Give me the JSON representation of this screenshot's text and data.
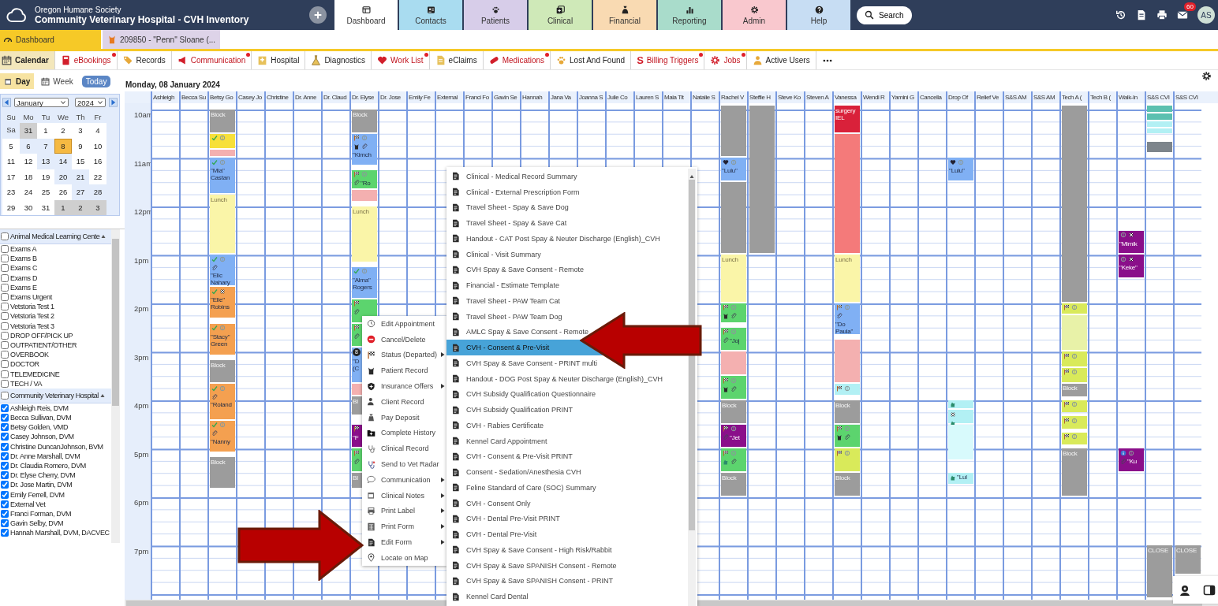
{
  "top_bar": {
    "org": "Oregon Humane Society",
    "title": "Community Veterinary Hospital - CVH Inventory",
    "search": "Search",
    "mail_count": "60",
    "user_initials": "AS"
  },
  "nav_tabs": [
    {
      "label": "Dashboard",
      "selected": true
    },
    {
      "label": "Contacts",
      "selected": false,
      "color": "#a9dcf0"
    },
    {
      "label": "Patients",
      "selected": false,
      "color": "#d7cde9"
    },
    {
      "label": "Clinical",
      "selected": false,
      "color": "#cfe9b8"
    },
    {
      "label": "Financial",
      "selected": false,
      "color": "#f9dab2"
    },
    {
      "label": "Reporting",
      "selected": false,
      "color": "#a9dccb"
    },
    {
      "label": "Admin",
      "selected": false,
      "color": "#f9c8ce"
    },
    {
      "label": "Help",
      "selected": false,
      "color": "#c7ddf3"
    }
  ],
  "open_tabs": [
    {
      "label": "Dashboard",
      "selected": true
    },
    {
      "label": "209850 - \"Penn\" Sloane (...",
      "selected": false
    }
  ],
  "toolbar": [
    {
      "label": "Calendar",
      "selected": true,
      "alert": false
    },
    {
      "label": "eBookings",
      "selected": false,
      "alert": true
    },
    {
      "label": "Records",
      "selected": false,
      "alert": false
    },
    {
      "label": "Communication",
      "selected": false,
      "alert": true
    },
    {
      "label": "Hospital",
      "selected": false,
      "alert": false
    },
    {
      "label": "Diagnostics",
      "selected": false,
      "alert": false
    },
    {
      "label": "Work List",
      "selected": false,
      "alert": true
    },
    {
      "label": "eClaims",
      "selected": false,
      "alert": false
    },
    {
      "label": "Medications",
      "selected": false,
      "alert": true
    },
    {
      "label": "Lost And Found",
      "selected": false,
      "alert": false
    },
    {
      "label": "Billing Triggers",
      "selected": false,
      "alert": true,
      "glyph": "S"
    },
    {
      "label": "Jobs",
      "selected": false,
      "alert": true
    },
    {
      "label": "Active Users",
      "selected": false,
      "alert": false
    }
  ],
  "view_switch": [
    {
      "label": "Day",
      "selected": true
    },
    {
      "label": "Week",
      "selected": false
    }
  ],
  "today_button": "Today",
  "mini_calendar": {
    "month": "January",
    "year": "2024",
    "weekdays": [
      "Su",
      "Mo",
      "Tu",
      "We",
      "Th",
      "Fr",
      "Sa"
    ],
    "days": [
      {
        "label": "31",
        "other_month": true,
        "selected": false
      },
      {
        "label": "1",
        "other_month": false,
        "selected": false
      },
      {
        "label": "2",
        "other_month": false,
        "selected": false
      },
      {
        "label": "3",
        "other_month": false,
        "selected": false
      },
      {
        "label": "4",
        "other_month": false,
        "selected": false
      },
      {
        "label": "5",
        "other_month": false,
        "selected": false
      },
      {
        "label": "6",
        "other_month": false,
        "selected": false
      },
      {
        "label": "7",
        "other_month": false,
        "selected": false
      },
      {
        "label": "8",
        "other_month": false,
        "selected": true
      },
      {
        "label": "9",
        "other_month": false,
        "selected": false
      },
      {
        "label": "10",
        "other_month": false,
        "selected": false
      },
      {
        "label": "11",
        "other_month": false,
        "selected": false
      },
      {
        "label": "12",
        "other_month": false,
        "selected": false
      },
      {
        "label": "13",
        "other_month": false,
        "selected": false
      },
      {
        "label": "14",
        "other_month": false,
        "selected": false
      },
      {
        "label": "15",
        "other_month": false,
        "selected": false
      },
      {
        "label": "16",
        "other_month": false,
        "selected": false
      },
      {
        "label": "17",
        "other_month": false,
        "selected": false
      },
      {
        "label": "18",
        "other_month": false,
        "selected": false
      },
      {
        "label": "19",
        "other_month": false,
        "selected": false
      },
      {
        "label": "20",
        "other_month": false,
        "selected": false
      },
      {
        "label": "21",
        "other_month": false,
        "selected": false
      },
      {
        "label": "22",
        "other_month": false,
        "selected": false
      },
      {
        "label": "23",
        "other_month": false,
        "selected": false
      },
      {
        "label": "24",
        "other_month": false,
        "selected": false
      },
      {
        "label": "25",
        "other_month": false,
        "selected": false
      },
      {
        "label": "26",
        "other_month": false,
        "selected": false
      },
      {
        "label": "27",
        "other_month": false,
        "selected": false
      },
      {
        "label": "28",
        "other_month": false,
        "selected": false
      },
      {
        "label": "29",
        "other_month": false,
        "selected": false
      },
      {
        "label": "30",
        "other_month": false,
        "selected": false
      },
      {
        "label": "31",
        "other_month": false,
        "selected": false
      },
      {
        "label": "1",
        "other_month": true,
        "selected": false
      },
      {
        "label": "2",
        "other_month": true,
        "selected": false
      },
      {
        "label": "3",
        "other_month": true,
        "selected": false
      }
    ]
  },
  "resource_groups": [
    {
      "name": "Animal Medical Learning Cente",
      "checked": false,
      "items": [
        {
          "label": "Exams A",
          "checked": false
        },
        {
          "label": "Exams B",
          "checked": false
        },
        {
          "label": "Exams C",
          "checked": false
        },
        {
          "label": "Exams D",
          "checked": false
        },
        {
          "label": "Exams E",
          "checked": false
        },
        {
          "label": "Exams Urgent",
          "checked": false
        },
        {
          "label": "Vetstoria Test 1",
          "checked": false
        },
        {
          "label": "Vetstoria Test 2",
          "checked": false
        },
        {
          "label": "Vetstoria Test 3",
          "checked": false
        },
        {
          "label": "DROP OFF/PICK UP",
          "checked": false
        },
        {
          "label": "OUTPATIENT/OTHER",
          "checked": false
        },
        {
          "label": "OVERBOOK",
          "checked": false
        },
        {
          "label": "DOCTOR",
          "checked": false
        },
        {
          "label": "TELEMEDICINE",
          "checked": false
        },
        {
          "label": "TECH / VA",
          "checked": false
        }
      ]
    },
    {
      "name": "Community Veterinary Hospital",
      "checked": false,
      "items": [
        {
          "label": "Ashleigh Reis, DVM",
          "checked": true
        },
        {
          "label": "Becca Sullivan, DVM",
          "checked": true
        },
        {
          "label": "Betsy Golden, VMD",
          "checked": true
        },
        {
          "label": "Casey Johnson, DVM",
          "checked": true
        },
        {
          "label": "Christine DuncanJohnson, BVM",
          "checked": true
        },
        {
          "label": "Dr. Anne Marshall, DVM",
          "checked": true
        },
        {
          "label": "Dr. Claudia Romero, DVM",
          "checked": true
        },
        {
          "label": "Dr. Elyse Cherry, DVM",
          "checked": true
        },
        {
          "label": "Dr. Jose Martin, DVM",
          "checked": true
        },
        {
          "label": "Emily Ferrell, DVM",
          "checked": true
        },
        {
          "label": "External Vet",
          "checked": true
        },
        {
          "label": "Franci Forman, DVM",
          "checked": true
        },
        {
          "label": "Gavin Selby, DVM",
          "checked": true
        },
        {
          "label": "Hannah Marshall, DVM, DACVEC",
          "checked": true
        }
      ]
    }
  ],
  "calendar": {
    "date": "Monday, 08 January 2024",
    "hours": [
      "10am",
      "11am",
      "12pm",
      "1pm",
      "2pm",
      "3pm",
      "4pm",
      "5pm",
      "6pm",
      "7pm"
    ],
    "columns": [
      {
        "name": "Ashleigh"
      },
      {
        "name": "Becca Su"
      },
      {
        "name": "Betsy Go",
        "appointments": [
          {
            "kind": "block",
            "text": "Block"
          },
          {
            "kind": "appointment",
            "color": "#f7e03a",
            "check": true,
            "coin": true
          },
          {
            "kind": "appointment",
            "color": "#f4b0b0"
          },
          {
            "kind": "appointment",
            "color": "#80b0f4",
            "check": true,
            "coin": true,
            "text": "\"Mia\" Castan"
          },
          {
            "kind": "lunch",
            "text": "Lunch"
          },
          {
            "kind": "appointment",
            "color": "#80b0f4",
            "check": true,
            "coin": true,
            "clip": true,
            "text": "\"Elic Nahary"
          },
          {
            "kind": "appointment",
            "color": "#f4a050",
            "check": true,
            "cross": true,
            "text": "\"Elle\" Robins"
          },
          {
            "kind": "appointment",
            "color": "#f4a050",
            "check": true,
            "coin": true,
            "text": "\"Stacy\" Green"
          },
          {
            "kind": "block",
            "text": "Block"
          },
          {
            "kind": "appointment",
            "color": "#f4a050",
            "check": true,
            "coin": true,
            "clip": true,
            "text": "\"Roland"
          },
          {
            "kind": "appointment",
            "color": "#f4a050",
            "check": true,
            "coin": true,
            "clip": true,
            "text": "\"Nanny"
          },
          {
            "kind": "block",
            "text": "Block"
          }
        ]
      },
      {
        "name": "Casey Jo"
      },
      {
        "name": "Christine"
      },
      {
        "name": "Dr. Anne"
      },
      {
        "name": "Dr. Claud"
      },
      {
        "name": "Dr. Elyse",
        "appointments": [
          {
            "kind": "block",
            "text": "Block"
          },
          {
            "kind": "appointment",
            "color": "#80b0f4",
            "flag": true,
            "coin": true,
            "cat": true,
            "clip": true,
            "text": "\"Kimch"
          },
          {
            "kind": "appointment",
            "color": "#5cd46e",
            "flag": true,
            "coin": true,
            "clip": true,
            "text": "\"Ro"
          },
          {
            "kind": "appointment",
            "color": "#f4b0b0"
          },
          {
            "kind": "lunch",
            "text": "Lunch"
          },
          {
            "kind": "appointment",
            "color": "#80b0f4",
            "check": true,
            "coin": true,
            "text": "\"Alma\" Rogers"
          },
          {
            "kind": "appointment",
            "color": "#5cd46e",
            "flag": true,
            "clip": true
          },
          {
            "kind": "appointment",
            "color": "#5cd46e",
            "flag": true,
            "clip": true
          },
          {
            "kind": "appointment",
            "color": "#80b0f4",
            "badge": "8",
            "text": "\"D (C"
          },
          {
            "kind": "appointment",
            "color": "#f4b0b0"
          },
          {
            "kind": "block",
            "text": "Bl"
          },
          {
            "kind": "appointment",
            "color": "#8a0f8a",
            "flag": true,
            "text": "\"F"
          },
          {
            "kind": "appointment",
            "color": "#5cd46e",
            "flag": true,
            "clip": true
          },
          {
            "kind": "block",
            "text": "Bl"
          }
        ]
      },
      {
        "name": "Dr. Jose"
      },
      {
        "name": "Emily Fe"
      },
      {
        "name": "External"
      },
      {
        "name": "Franci Fo"
      },
      {
        "name": "Gavin Se"
      },
      {
        "name": "Hannah"
      },
      {
        "name": "Jana Va"
      },
      {
        "name": "Joanna S"
      },
      {
        "name": "Julie Co"
      },
      {
        "name": "Lauren S"
      },
      {
        "name": "Maia Tit"
      },
      {
        "name": "Natalie S"
      },
      {
        "name": "Rachel V",
        "appointments": [
          {
            "kind": "block"
          },
          {
            "kind": "appointment",
            "color": "#80b0f4",
            "heart": true,
            "coin": true,
            "text": "\"Lulu\""
          },
          {
            "kind": "block"
          },
          {
            "kind": "lunch",
            "text": "Lunch"
          },
          {
            "kind": "appointment",
            "color": "#5cd46e",
            "flag": true,
            "coin": true,
            "cat": true,
            "clip": true
          },
          {
            "kind": "appointment",
            "color": "#5cd46e",
            "flag": true,
            "coin": true,
            "clip": true,
            "text": "\"Joj"
          },
          {
            "kind": "appointment",
            "color": "#f4b0b0"
          },
          {
            "kind": "appointment",
            "color": "#5cd46e",
            "flag": true,
            "coin": true,
            "cat": true,
            "clip": true
          },
          {
            "kind": "block",
            "text": "Block"
          },
          {
            "kind": "appointment",
            "color": "#8a0f8a",
            "flag": true,
            "coin": true,
            "clip": true,
            "text": "\"Jet"
          },
          {
            "kind": "appointment",
            "color": "#5cd46e",
            "flag": true,
            "coin": true,
            "dog": true,
            "clip": true
          },
          {
            "kind": "block",
            "text": "Block"
          }
        ]
      },
      {
        "name": "Steffie H",
        "appointments": [
          {
            "kind": "block"
          }
        ]
      },
      {
        "name": "Steve Ko"
      },
      {
        "name": "Steven A"
      },
      {
        "name": "Vanessa",
        "appointments": [
          {
            "kind": "appointment",
            "color": "#d9213a",
            "text": "surgery IEL"
          },
          {
            "kind": "appointment",
            "color": "#f47a7a"
          },
          {
            "kind": "lunch",
            "text": "Lunch"
          },
          {
            "kind": "appointment",
            "color": "#80b0f4",
            "flag": true,
            "coin": true,
            "clip": true,
            "text": "\"Do Paula\""
          },
          {
            "kind": "appointment",
            "color": "#f4b0b0"
          },
          {
            "kind": "appointment",
            "color": "#b2f0f4",
            "flag": true,
            "coin": true
          },
          {
            "kind": "block",
            "text": "Block"
          },
          {
            "kind": "appointment",
            "color": "#5cd46e",
            "flag": true,
            "coin": true,
            "cat": true,
            "clip": true
          },
          {
            "kind": "appointment",
            "color": "#d9ea5a",
            "flag": true,
            "coin": true
          },
          {
            "kind": "block",
            "text": "Block"
          }
        ]
      },
      {
        "name": "Wendi R"
      },
      {
        "name": "Yamini G"
      },
      {
        "name": "Cancella"
      },
      {
        "name": "Drop Of",
        "appointments": [
          {
            "kind": "appointment",
            "color": "#80b0f4",
            "heart": true,
            "coin": true,
            "text": "\"Lulu\""
          },
          {
            "kind": "appointment",
            "color": "#b2f0f4",
            "dog": true
          },
          {
            "kind": "appointment",
            "color": "#b2f0f4",
            "dog": true,
            "cross": true
          },
          {
            "kind": "appointment",
            "color": "#d8fafc"
          },
          {
            "kind": "appointment",
            "color": "#b2f0f4",
            "dog": true,
            "text": "\"Lul"
          }
        ]
      },
      {
        "name": "Relief Ve"
      },
      {
        "name": "S&S AM"
      },
      {
        "name": "S&S AM"
      },
      {
        "name": "Tech A (",
        "appointments": [
          {
            "kind": "block"
          },
          {
            "kind": "appointment",
            "color": "#d9ea5a",
            "flag": true,
            "coin": true
          },
          {
            "kind": "appointment",
            "color": "#e8f2a8"
          },
          {
            "kind": "appointment",
            "color": "#d9ea5a",
            "flag": true,
            "coin": true
          },
          {
            "kind": "appointment",
            "color": "#d9ea5a",
            "flag": true,
            "coin": true
          },
          {
            "kind": "block",
            "text": "Block"
          },
          {
            "kind": "appointment",
            "color": "#d9ea5a",
            "flag": true,
            "coin": true
          },
          {
            "kind": "appointment",
            "color": "#d9ea5a",
            "flag": true,
            "coin": true
          },
          {
            "kind": "appointment",
            "color": "#d9ea5a",
            "flag": true,
            "coin": true
          },
          {
            "kind": "block",
            "text": "Block"
          }
        ]
      },
      {
        "name": "Tech B ("
      },
      {
        "name": "Walk-In",
        "appointments": [
          {
            "kind": "appointment",
            "color": "#8a0f8a",
            "coin": true,
            "cross": true,
            "text": "\"Mimik"
          },
          {
            "kind": "appointment",
            "color": "#8a0f8a",
            "coin": true,
            "cross": true,
            "text": "\"Keke\""
          },
          {
            "kind": "appointment",
            "color": "#8a0f8a",
            "info": true,
            "coin": true,
            "clip": true,
            "text": "\"Ku"
          }
        ]
      },
      {
        "name": "S&S CVI",
        "appointments": [
          {
            "kind": "appointment",
            "color": "#5bc0b0"
          },
          {
            "kind": "appointment",
            "color": "#5bc0b0"
          },
          {
            "kind": "appointment",
            "color": "#b2f0f4"
          },
          {
            "kind": "appointment",
            "color": "#b2f0f4"
          },
          {
            "kind": "appointment",
            "color": "#7d858c"
          },
          {
            "kind": "block",
            "text": "CLOSE"
          }
        ]
      },
      {
        "name": "S&S CVI",
        "appointments": [
          {
            "kind": "block",
            "text": "CLOSE"
          }
        ]
      }
    ]
  },
  "context_menu": [
    {
      "label": "Edit Appointment",
      "submenu": false
    },
    {
      "label": "Cancel/Delete",
      "submenu": false
    },
    {
      "label": "Status (Departed)",
      "submenu": true
    },
    {
      "label": "Patient Record",
      "submenu": false
    },
    {
      "label": "Insurance Offers",
      "submenu": true
    },
    {
      "label": "Client Record",
      "submenu": false
    },
    {
      "label": "Pay Deposit",
      "submenu": false
    },
    {
      "label": "Complete History",
      "submenu": false
    },
    {
      "label": "Clinical Record",
      "submenu": false
    },
    {
      "label": "Send to Vet Radar",
      "submenu": false
    },
    {
      "label": "Communication",
      "submenu": true
    },
    {
      "label": "Clinical Notes",
      "submenu": true
    },
    {
      "label": "Print Label",
      "submenu": true
    },
    {
      "label": "Print Form",
      "submenu": true
    },
    {
      "label": "Edit Form",
      "submenu": true
    },
    {
      "label": "Locate on Map",
      "submenu": false
    }
  ],
  "form_submenu": [
    {
      "label": "Clinical - Medical Record Summary",
      "selected": false
    },
    {
      "label": "Clinical - External Prescription Form",
      "selected": false
    },
    {
      "label": "Travel Sheet - Spay & Save Dog",
      "selected": false
    },
    {
      "label": "Travel Sheet - Spay & Save Cat",
      "selected": false
    },
    {
      "label": "Handout - CAT Post Spay & Neuter Discharge (English)_CVH",
      "selected": false
    },
    {
      "label": "Clinical - Visit Summary",
      "selected": false
    },
    {
      "label": "CVH Spay & Save Consent - Remote",
      "selected": false
    },
    {
      "label": "Financial - Estimate Template",
      "selected": false
    },
    {
      "label": "Travel Sheet - PAW Team Cat",
      "selected": false
    },
    {
      "label": "Travel Sheet - PAW Team Dog",
      "selected": false
    },
    {
      "label": "AMLC Spay & Save Consent - Remote",
      "selected": false
    },
    {
      "label": "CVH - Consent & Pre-Visit",
      "selected": true
    },
    {
      "label": "CVH Spay & Save Consent - PRINT multi",
      "selected": false
    },
    {
      "label": "Handout - DOG Post Spay & Neuter Discharge (English)_CVH",
      "selected": false
    },
    {
      "label": "CVH Subsidy Qualification Questionnaire",
      "selected": false
    },
    {
      "label": "CVH Subsidy Qualification PRINT",
      "selected": false
    },
    {
      "label": "CVH - Rabies Certificate",
      "selected": false
    },
    {
      "label": "Kennel Card Appointment",
      "selected": false
    },
    {
      "label": "CVH - Consent & Pre-Visit PRINT",
      "selected": false
    },
    {
      "label": "Consent - Sedation/Anesthesia CVH",
      "selected": false
    },
    {
      "label": "Feline Standard of Care (SOC) Summary",
      "selected": false
    },
    {
      "label": "CVH - Consent Only",
      "selected": false
    },
    {
      "label": "CVH - Dental Pre-Visit PRINT",
      "selected": false
    },
    {
      "label": "CVH - Dental Pre-Visit",
      "selected": false
    },
    {
      "label": "CVH Spay & Save Consent - High Risk/Rabbit",
      "selected": false
    },
    {
      "label": "CVH Spay & Save SPANISH Consent - Remote",
      "selected": false
    },
    {
      "label": "CVH Spay & Save SPANISH Consent - PRINT",
      "selected": false
    },
    {
      "label": "Kennel Card Dental",
      "selected": false
    }
  ]
}
